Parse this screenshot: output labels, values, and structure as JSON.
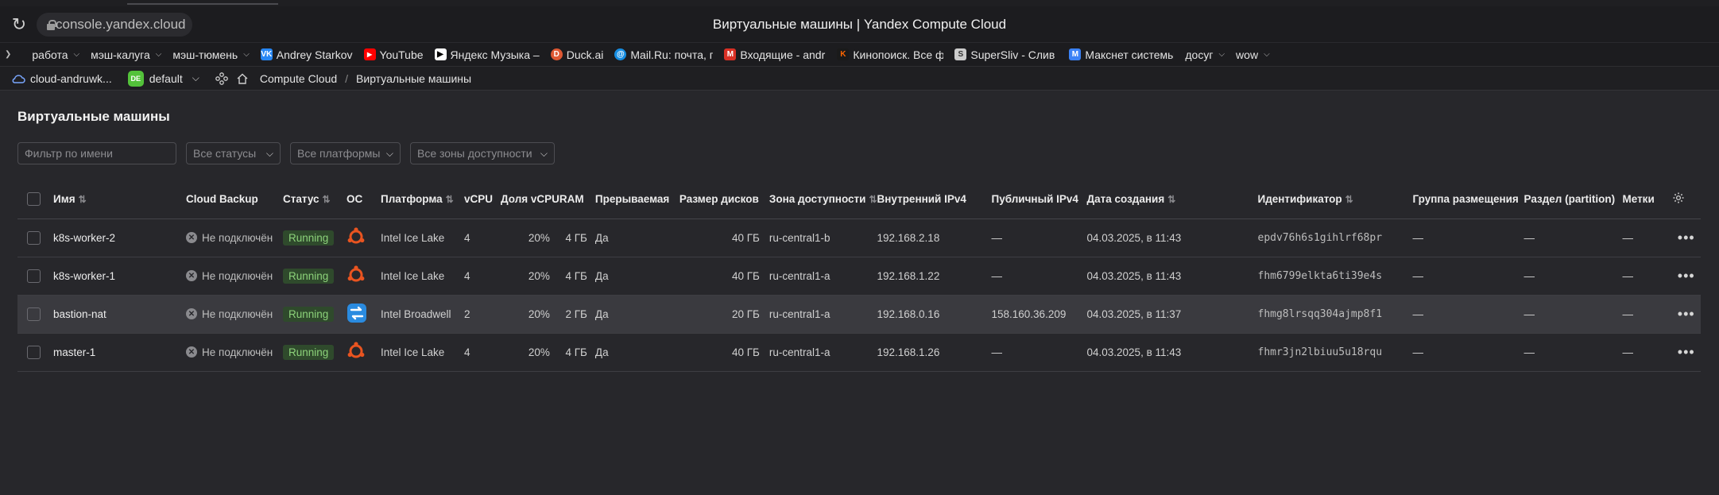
{
  "browser": {
    "url": "console.yandex.cloud",
    "window_title": "Виртуальные машины | Yandex Compute Cloud"
  },
  "bookmarks": [
    {
      "label": "работа",
      "dropdown": true,
      "icon": "folder-icon"
    },
    {
      "label": "мэш-калуга",
      "dropdown": true,
      "icon": "folder-icon"
    },
    {
      "label": "мэш-тюмень",
      "dropdown": true,
      "icon": "folder-icon"
    },
    {
      "label": "Andrey Starkov",
      "icon": "vk-icon",
      "icon_color": "#2787f5",
      "icon_text": "VK"
    },
    {
      "label": "YouTube",
      "icon": "youtube-icon",
      "icon_color": "#ff0000",
      "icon_text": "▶"
    },
    {
      "label": "Яндекс Музыка –",
      "icon": "yandex-music-icon",
      "icon_color": "#ffffff",
      "icon_text": "♪"
    },
    {
      "label": "Duck.ai",
      "icon": "duckduckgo-icon",
      "icon_color": "#de5833",
      "icon_text": "D"
    },
    {
      "label": "Mail.Ru: почта, пои",
      "icon": "mailru-icon",
      "icon_color": "#168de2",
      "icon_text": "@"
    },
    {
      "label": "Входящие - andru",
      "icon": "gmail-icon",
      "icon_color": "#d93025",
      "icon_text": "M"
    },
    {
      "label": "Кинопоиск. Все ф",
      "icon": "kinopoisk-icon",
      "icon_color": "#ff6600",
      "icon_text": "K"
    },
    {
      "label": "SuperSliv - Слив I",
      "icon": "supersliv-icon",
      "icon_color": "#cccccc",
      "icon_text": "S"
    },
    {
      "label": "Макснет системы",
      "icon": "maksnet-icon",
      "icon_color": "#3b82f6",
      "icon_text": "M"
    },
    {
      "label": "досуг",
      "dropdown": true,
      "icon": "folder-icon"
    },
    {
      "label": "wow",
      "dropdown": true,
      "icon": "folder-icon"
    }
  ],
  "appbar": {
    "cloud": "cloud-andruwk...",
    "folder_badge": "DE",
    "folder": "default",
    "service": "Compute Cloud",
    "page": "Виртуальные машины"
  },
  "page_title": "Виртуальные машины",
  "filters": {
    "name_placeholder": "Фильтр по имени",
    "status": "Все статусы",
    "platform": "Все платформы",
    "zone": "Все зоны доступности"
  },
  "columns": {
    "name": "Имя",
    "backup": "Cloud Backup",
    "status": "Статус",
    "os": "ОС",
    "platform": "Платформа",
    "vcpu": "vCPU",
    "share": "Доля vCPU",
    "ram": "RAM",
    "preemptible": "Прерываемая",
    "disk": "Размер дисков",
    "zone": "Зона доступности",
    "internal_ip": "Внутренний IPv4",
    "public_ip": "Публичный IPv4",
    "created": "Дата создания",
    "id": "Идентификатор",
    "placement": "Группа размещения",
    "partition": "Раздел (partition)",
    "labels": "Метки"
  },
  "rows": [
    {
      "name": "k8s-worker-2",
      "backup": "Не подключён",
      "status": "Running",
      "os": "ubuntu",
      "platform": "Intel Ice Lake",
      "vcpu": "4",
      "share": "20%",
      "ram": "4 ГБ",
      "preemptible": "Да",
      "disk": "40 ГБ",
      "zone": "ru-central1-b",
      "internal_ip": "192.168.2.18",
      "public_ip": "—",
      "created": "04.03.2025, в 11:43",
      "id": "epdv76h6s1gihlrf68pr",
      "placement": "—",
      "partition": "—",
      "labels": "—"
    },
    {
      "name": "k8s-worker-1",
      "backup": "Не подключён",
      "status": "Running",
      "os": "ubuntu",
      "platform": "Intel Ice Lake",
      "vcpu": "4",
      "share": "20%",
      "ram": "4 ГБ",
      "preemptible": "Да",
      "disk": "40 ГБ",
      "zone": "ru-central1-a",
      "internal_ip": "192.168.1.22",
      "public_ip": "—",
      "created": "04.03.2025, в 11:43",
      "id": "fhm6799elkta6ti39e4s",
      "placement": "—",
      "partition": "—",
      "labels": "—"
    },
    {
      "name": "bastion-nat",
      "backup": "Не подключён",
      "status": "Running",
      "os": "nat-instance",
      "platform": "Intel Broadwell",
      "vcpu": "2",
      "share": "20%",
      "ram": "2 ГБ",
      "preemptible": "Да",
      "disk": "20 ГБ",
      "zone": "ru-central1-a",
      "internal_ip": "192.168.0.16",
      "public_ip": "158.160.36.209",
      "created": "04.03.2025, в 11:37",
      "id": "fhmg8lrsqq304ajmp8f1",
      "placement": "—",
      "partition": "—",
      "labels": "—"
    },
    {
      "name": "master-1",
      "backup": "Не подключён",
      "status": "Running",
      "os": "ubuntu",
      "platform": "Intel Ice Lake",
      "vcpu": "4",
      "share": "20%",
      "ram": "4 ГБ",
      "preemptible": "Да",
      "disk": "40 ГБ",
      "zone": "ru-central1-a",
      "internal_ip": "192.168.1.26",
      "public_ip": "—",
      "created": "04.03.2025, в 11:43",
      "id": "fhmr3jn2lbiuu5u18rqu",
      "placement": "—",
      "partition": "—",
      "labels": "—"
    }
  ],
  "colors": {
    "status_running_bg": "#2f4a2c",
    "status_running_text": "#8cd27a",
    "ubuntu": "#e95420",
    "nat": "#2a8be0",
    "highlight_row": "#3a3a3f"
  }
}
